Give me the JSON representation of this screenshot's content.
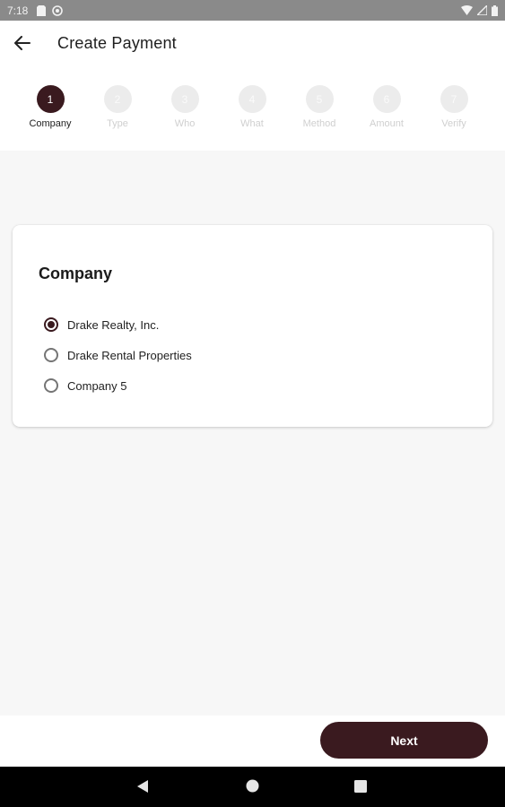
{
  "status_bar": {
    "time": "7:18",
    "left_icons": [
      "sd-card-icon",
      "sync-icon"
    ],
    "right_icons": [
      "wifi-icon",
      "signal-icon",
      "battery-icon"
    ]
  },
  "app_bar": {
    "title": "Create Payment",
    "back_icon": "arrow-left-icon"
  },
  "stepper": {
    "steps": [
      {
        "number": "1",
        "label": "Company",
        "active": true
      },
      {
        "number": "2",
        "label": "Type",
        "active": false
      },
      {
        "number": "3",
        "label": "Who",
        "active": false
      },
      {
        "number": "4",
        "label": "What",
        "active": false
      },
      {
        "number": "5",
        "label": "Method",
        "active": false
      },
      {
        "number": "6",
        "label": "Amount",
        "active": false
      },
      {
        "number": "7",
        "label": "Verify",
        "active": false
      }
    ]
  },
  "company_card": {
    "title": "Company",
    "options": [
      {
        "label": "Drake Realty, Inc.",
        "selected": true
      },
      {
        "label": "Drake Rental Properties",
        "selected": false
      },
      {
        "label": "Company 5",
        "selected": false
      }
    ]
  },
  "actions": {
    "next_label": "Next"
  },
  "nav_bar": {
    "icons": [
      "back-triangle-icon",
      "home-circle-icon",
      "recents-square-icon"
    ]
  },
  "colors": {
    "accent": "#3a1a1f",
    "inactive_step": "#ececec",
    "background": "#f7f7f7"
  }
}
